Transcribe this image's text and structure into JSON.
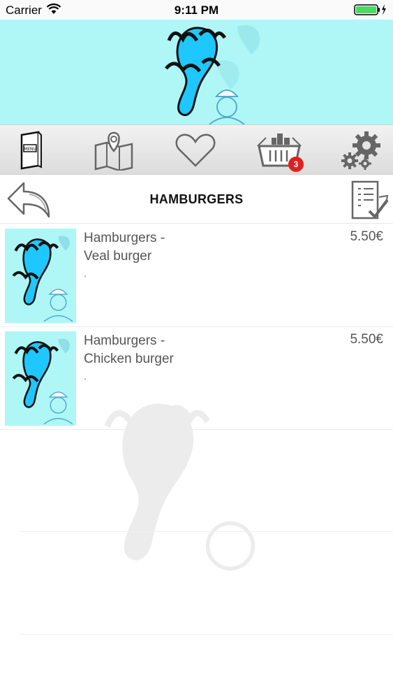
{
  "status_bar": {
    "carrier": "Carrier",
    "time": "9:11 PM",
    "battery_color": "#4cd964"
  },
  "header": {
    "background_color": "#aff7f7",
    "logo_icon": "restaurant-logo-icon"
  },
  "toolbar": {
    "items": [
      {
        "icon": "menu-book-icon"
      },
      {
        "icon": "map-icon"
      },
      {
        "icon": "heart-icon"
      },
      {
        "icon": "basket-icon",
        "badge": "3"
      },
      {
        "icon": "settings-gears-icon"
      }
    ],
    "badge_color": "#e02020"
  },
  "titlebar": {
    "title": "HAMBURGERS",
    "back_icon": "back-arrow-icon",
    "order_icon": "order-list-icon"
  },
  "items": [
    {
      "name_line1": "Hamburgers -",
      "name_line2": "Veal burger",
      "description": ".",
      "price": "5.50€"
    },
    {
      "name_line1": "Hamburgers -",
      "name_line2": "Chicken burger",
      "description": ".",
      "price": "5.50€"
    }
  ]
}
